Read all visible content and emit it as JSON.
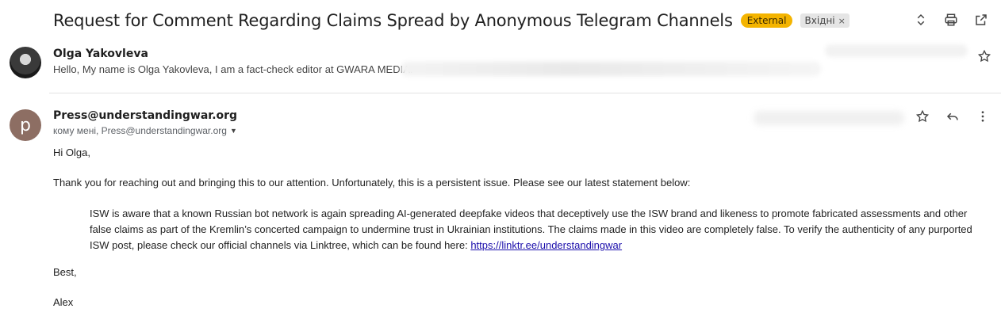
{
  "subject": "Request for Comment Regarding Claims Spread by Anonymous Telegram Channels",
  "labels": {
    "external": "External",
    "inbox": "Вхідні",
    "inbox_remove": "×"
  },
  "toolbar_icons": [
    "unfold-icon",
    "print-icon",
    "open-in-new-window-icon"
  ],
  "message1": {
    "sender": "Olga Yakovleva",
    "snippet": "Hello, My name is Olga Yakovleva, I am a fact-check editor at GWARA MEDIA."
  },
  "message2": {
    "avatar_letter": "p",
    "sender": "Press@understandingwar.org",
    "recipients": "кому мені, Press@understandingwar.org",
    "greeting": "Hi Olga,",
    "intro": "Thank you for reaching out and bringing this to our attention. Unfortunately, this is a persistent issue. Please see our latest statement below:",
    "quote_text": "ISW is aware that a known Russian bot network is again spreading AI-generated deepfake videos that deceptively use the ISW brand and likeness to promote fabricated assessments and other false claims as part of the Kremlin’s concerted campaign to undermine trust in Ukrainian institutions. The claims made in this video are completely false. To verify the authenticity of any purported ISW post, please check our official channels via Linktree, which can be found here: ",
    "link": "https://linktr.ee/understandingwar",
    "signoff": "Best,",
    "signature": "Alex"
  },
  "colors": {
    "external_badge": "#f4b400",
    "avatar_p": "#8d6e63",
    "link": "#1a0dab"
  }
}
